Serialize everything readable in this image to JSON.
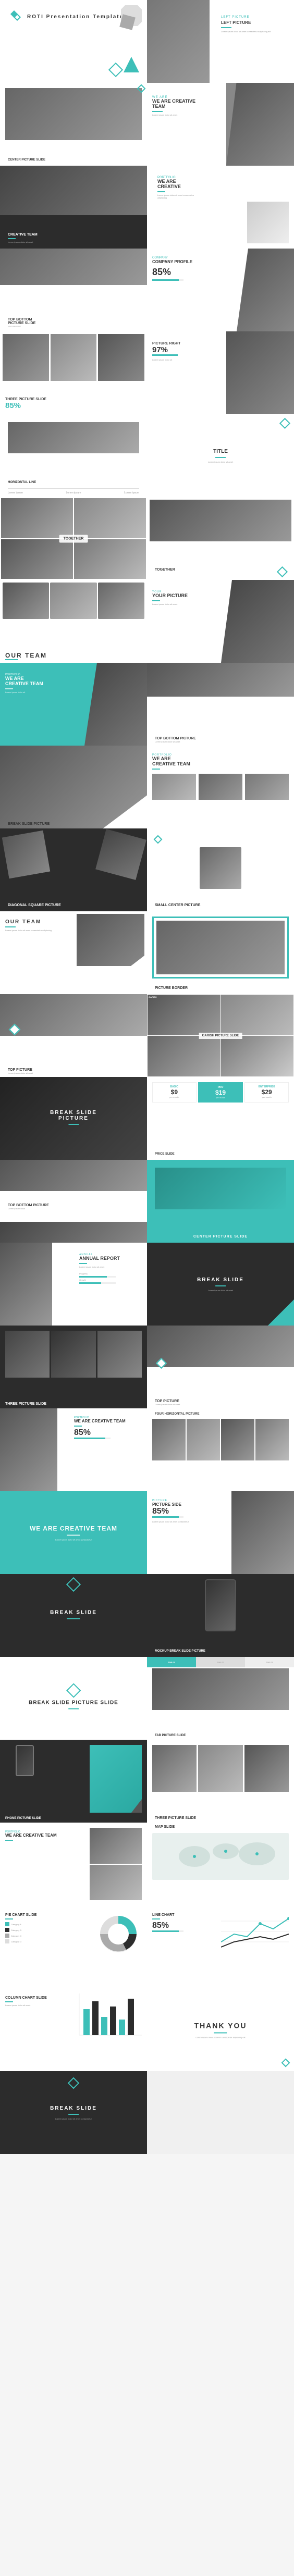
{
  "app": {
    "title": "ROTI Presentation Template"
  },
  "slides": [
    {
      "id": 1,
      "type": "cover",
      "title": "ROTI",
      "subtitle": "Presentation Template",
      "bg": "white"
    },
    {
      "id": 2,
      "type": "left-picture",
      "title": "LEFT PICTURE",
      "bg": "white"
    },
    {
      "id": 3,
      "type": "center-picture",
      "title": "CENTER PICTURE SLIDE",
      "bg": "white"
    },
    {
      "id": 4,
      "type": "we-are-creative",
      "title": "WE ARE CREATIVE TEAM",
      "bg": "white"
    },
    {
      "id": 5,
      "type": "creative-team",
      "title": "CREATIVE TEAM",
      "bg": "dark"
    },
    {
      "id": 6,
      "type": "we-are-creative-2",
      "title": "WE ARE CREATIVE",
      "bg": "white"
    },
    {
      "id": 7,
      "type": "top-bottom",
      "title": "TOP BOTTOM PICTURE SLIDE",
      "bg": "white"
    },
    {
      "id": 8,
      "type": "company-profile",
      "title": "COMPANY PROFILE",
      "bg": "white"
    },
    {
      "id": 9,
      "type": "three-picture",
      "title": "THREE PICTURE SLIDE",
      "percent": "85%",
      "bg": "white"
    },
    {
      "id": 10,
      "type": "picture-right",
      "title": "PICTURE RIGHT",
      "percent": "97%",
      "bg": "white"
    },
    {
      "id": 11,
      "type": "horizontal-line",
      "title": "HORIZONTAL LINE",
      "bg": "white"
    },
    {
      "id": 12,
      "type": "title-only",
      "title": "TITLE",
      "bg": "white"
    },
    {
      "id": 13,
      "type": "together",
      "title": "TOGETHER",
      "bg": "white"
    },
    {
      "id": 14,
      "type": "together-2",
      "title": "TOGETHER",
      "bg": "white"
    },
    {
      "id": 15,
      "type": "our-team",
      "title": "OUR TEAM",
      "bg": "white"
    },
    {
      "id": 16,
      "type": "your-picture",
      "title": "YOUR PICTURE",
      "bg": "white"
    },
    {
      "id": 17,
      "type": "we-are-creative-team",
      "title": "WE ARE CREATIVE TEAM",
      "bg": "teal"
    },
    {
      "id": 18,
      "type": "top-bottom-2",
      "title": "TOP BOTTOM PICTURE",
      "bg": "white"
    },
    {
      "id": 19,
      "type": "break-slide",
      "title": "BREAK SLIDE PICTURE",
      "bg": "white"
    },
    {
      "id": 20,
      "type": "we-are-creative-team-2",
      "title": "WE ARE CREATIVE TEAM",
      "bg": "white"
    },
    {
      "id": 21,
      "type": "diagonal",
      "title": "DIAGONAL SQUARE PICTURE",
      "bg": "dark"
    },
    {
      "id": 22,
      "type": "small-center",
      "title": "SMALL CENTER PICTURE",
      "bg": "white"
    },
    {
      "id": 23,
      "type": "our-team-2",
      "title": "OUR TEAM",
      "bg": "white"
    },
    {
      "id": 24,
      "type": "picture-border",
      "title": "PICTURE BORDER",
      "bg": "white"
    },
    {
      "id": 25,
      "type": "top-picture",
      "title": "TOP PICTURE",
      "bg": "white"
    },
    {
      "id": 26,
      "type": "garish",
      "title": "GARISH PICTURE SLIDE",
      "bg": "white"
    },
    {
      "id": 27,
      "type": "break-dark",
      "title": "BREAK SLIDE PICTURE",
      "bg": "dark"
    },
    {
      "id": 28,
      "type": "price-slide",
      "title": "PRICE SLIDE",
      "bg": "white"
    },
    {
      "id": 29,
      "type": "top-bottom-3",
      "title": "TOP BOTTOM PICTURE",
      "bg": "white"
    },
    {
      "id": 30,
      "type": "center-picture-2",
      "title": "CENTER PICTURE SLIDE",
      "bg": "teal"
    },
    {
      "id": 31,
      "type": "annual-report",
      "title": "ANNUAL REPORT",
      "bg": "white"
    },
    {
      "id": 32,
      "type": "break-slide-2",
      "title": "BREAK SLIDE",
      "bg": "dark"
    },
    {
      "id": 33,
      "type": "three-picture-2",
      "title": "THREE PICTURE SLIDE",
      "bg": "dark"
    },
    {
      "id": 34,
      "type": "top-picture-2",
      "title": "TOP PICTURE",
      "bg": "white"
    },
    {
      "id": 35,
      "type": "we-are-creative-team-3",
      "title": "WE ARE CREATIVE TEAM",
      "percent": "85%",
      "bg": "white"
    },
    {
      "id": 36,
      "type": "four-horizontal",
      "title": "FOUR HORIZONTAL PICTURE",
      "bg": "white"
    },
    {
      "id": 37,
      "type": "we-are-creative-team-4",
      "title": "WE ARE CREATIVE TEAM",
      "bg": "teal"
    },
    {
      "id": 38,
      "type": "picture-side",
      "title": "PICTURE SIDE",
      "percent": "85%",
      "bg": "white"
    },
    {
      "id": 39,
      "type": "break-slide-3",
      "title": "BREAK SLIDE",
      "bg": "dark"
    },
    {
      "id": 40,
      "type": "mockup",
      "title": "MOCKUP BREAK SLIDE PICTURE",
      "bg": "dark"
    },
    {
      "id": 41,
      "type": "break-slide-4",
      "title": "BREAK SLIDE PICTURE SLIDE",
      "bg": "white"
    },
    {
      "id": 42,
      "type": "tab-picture",
      "title": "TAB PICTURE SLIDE",
      "bg": "white"
    },
    {
      "id": 43,
      "type": "phone-picture",
      "title": "PHONE PICTURE SLIDE",
      "bg": "dark"
    },
    {
      "id": 44,
      "type": "three-picture-3",
      "title": "THREE PICTURE SLIDE",
      "bg": "white"
    },
    {
      "id": 45,
      "type": "we-are-creative-5",
      "title": "WE ARE CREATIVE TEAM",
      "bg": "white"
    },
    {
      "id": 46,
      "type": "map-slide",
      "title": "MAP SLIDE",
      "bg": "white"
    },
    {
      "id": 47,
      "type": "pie-chart",
      "title": "PIE CHART SLIDE",
      "bg": "white"
    },
    {
      "id": 48,
      "type": "line-chart",
      "title": "LINE CHART",
      "percent": "85%",
      "bg": "white"
    },
    {
      "id": 49,
      "type": "column-chart",
      "title": "COLUMN CHART SLIDE",
      "bg": "white"
    },
    {
      "id": 50,
      "type": "thank-you",
      "title": "THANK YOU",
      "bg": "white"
    },
    {
      "id": 51,
      "type": "break-slide-final",
      "title": "BREAK SLIDE",
      "bg": "dark"
    }
  ],
  "colors": {
    "teal": "#3dbfb8",
    "dark": "#2c2c2c",
    "black": "#1a1a1a",
    "white": "#ffffff",
    "gray": "#888888",
    "lightgray": "#eeeeee"
  }
}
